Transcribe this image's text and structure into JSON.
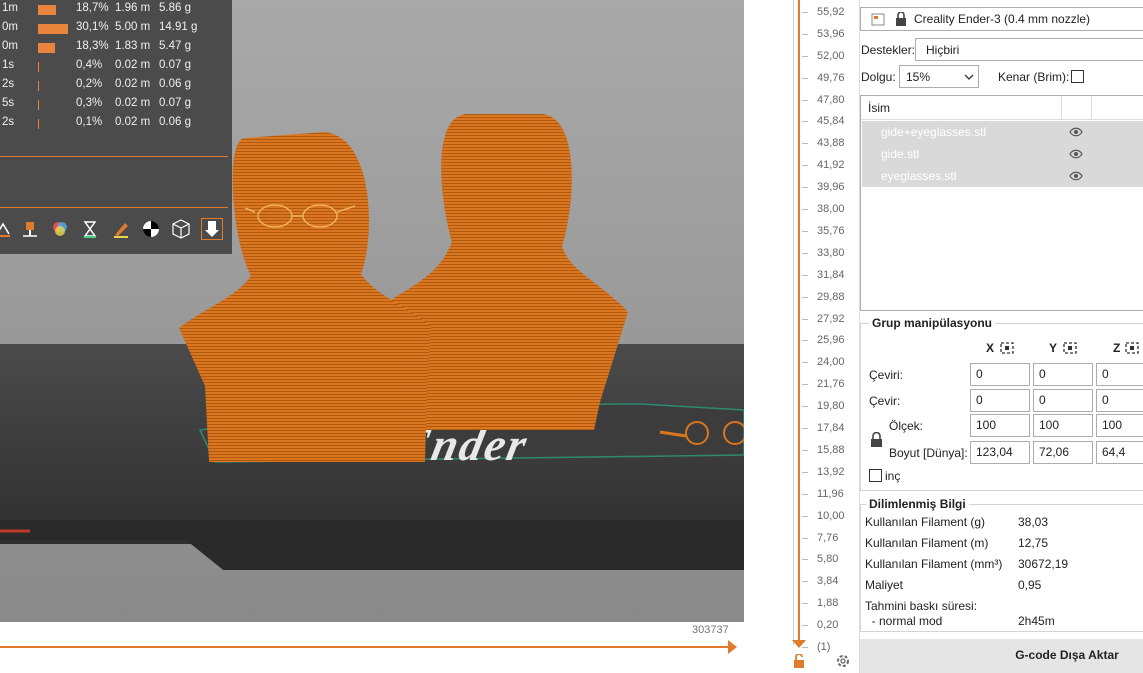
{
  "colors": {
    "accent": "#e07b2b",
    "model": "#d9761f",
    "legend_bg": "#4b4b4b",
    "bar": "#e8843c"
  },
  "legend": {
    "rows": [
      {
        "time": "1m",
        "pct": "18,7%",
        "length": "1.96 m",
        "weight": "5.86 g",
        "share": 0.187
      },
      {
        "time": "0m",
        "pct": "30,1%",
        "length": "5.00 m",
        "weight": "14.91 g",
        "share": 0.301
      },
      {
        "time": "0m",
        "pct": "18,3%",
        "length": "1.83 m",
        "weight": "5.47 g",
        "share": 0.183
      },
      {
        "time": "1s",
        "pct": "0,4%",
        "length": "0.02 m",
        "weight": "0.07 g",
        "share": 0.004
      },
      {
        "time": "2s",
        "pct": "0,2%",
        "length": "0.02 m",
        "weight": "0.06 g",
        "share": 0.002
      },
      {
        "time": "5s",
        "pct": "0,3%",
        "length": "0.02 m",
        "weight": "0.07 g",
        "share": 0.003
      },
      {
        "time": "2s",
        "pct": "0,1%",
        "length": "0.02 m",
        "weight": "0.06 g",
        "share": 0.001
      }
    ],
    "tool_icons": [
      "layers-icon",
      "extruder-icon",
      "color-icon",
      "hourglass-icon",
      "pen-icon",
      "contrast-icon",
      "cube-wireframe-icon",
      "export-down-icon"
    ]
  },
  "viewport": {
    "bed_logo": "Ender",
    "layer_count": "303737"
  },
  "vslider": {
    "ticks": [
      "55,92",
      "53,96",
      "52,00",
      "49,76",
      "47,80",
      "45,84",
      "43,88",
      "41,92",
      "39,96",
      "38,00",
      "35,76",
      "33,80",
      "31,84",
      "29,88",
      "27,92",
      "25,96",
      "24,00",
      "21,76",
      "19,80",
      "17,84",
      "15,88",
      "13,92",
      "11,96",
      "10,00",
      "7,76",
      "5,80",
      "3,84",
      "1,88",
      "0,20",
      "(1)"
    ]
  },
  "panel": {
    "printer": "Creality Ender-3 (0.4 mm nozzle)",
    "supports_label": "Destekler:",
    "supports_value": "Hiçbiri",
    "infill_label": "Dolgu:",
    "infill_value": "15%",
    "brim_label": "Kenar (Brim):",
    "objects_header": "İsim",
    "objects": [
      "gide+eyeglasses.stl",
      "gide.stl",
      "eyeglasses.stl"
    ],
    "group_title": "Grup manipülasyonu",
    "axes": [
      "X",
      "Y",
      "Z"
    ],
    "rows": [
      {
        "label": "Çeviri:",
        "values": [
          "0",
          "0",
          "0"
        ]
      },
      {
        "label": "Çevir:",
        "values": [
          "0",
          "0",
          "0"
        ]
      },
      {
        "label": "Ölçek:",
        "values": [
          "100",
          "100",
          "100"
        ]
      },
      {
        "label": "Boyut [Dünya]:",
        "values": [
          "123,04",
          "72,06",
          "64,4"
        ]
      }
    ],
    "inch_label": "inç",
    "sliced_title": "Dilimlenmiş Bilgi",
    "sliced": [
      {
        "label": "Kullanılan Filament (g)",
        "value": "38,03"
      },
      {
        "label": "Kullanılan Filament (m)",
        "value": "12,75"
      },
      {
        "label": "Kullanılan Filament (mm³)",
        "value": "30672,19"
      },
      {
        "label": "Maliyet",
        "value": "0,95"
      },
      {
        "label": "Tahmini baskı süresi:",
        "value": ""
      },
      {
        "label": "  - normal mod",
        "value": "2h45m"
      }
    ],
    "export_label": "G-code Dışa Aktar"
  }
}
